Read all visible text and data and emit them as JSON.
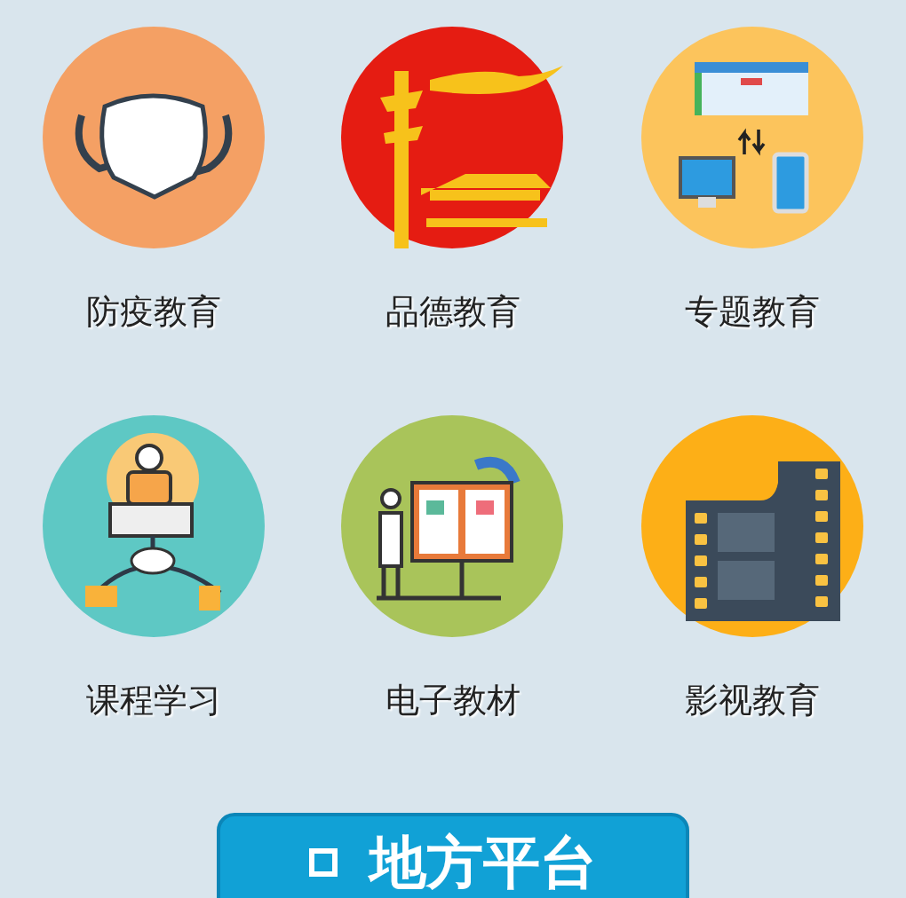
{
  "items": [
    {
      "kind": "mask",
      "label": "防疫教育"
    },
    {
      "kind": "tiananmen",
      "label": "品德教育"
    },
    {
      "kind": "sync",
      "label": "专题教育"
    },
    {
      "kind": "lecture",
      "label": "课程学习"
    },
    {
      "kind": "ebook",
      "label": "电子教材"
    },
    {
      "kind": "film",
      "label": "影视教育"
    }
  ],
  "button": {
    "label": "地方平台"
  }
}
